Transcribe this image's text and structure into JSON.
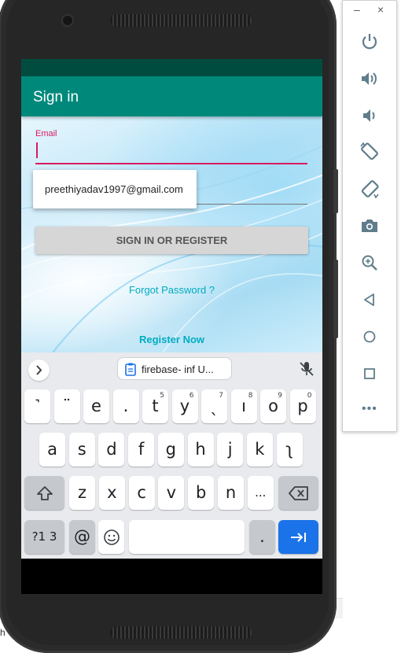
{
  "window": {
    "minimize_label": "–",
    "close_label": "×"
  },
  "desktop": {
    "fragment_text": "h"
  },
  "app": {
    "title": "Sign in",
    "email_label": "Email",
    "email_value": "",
    "autofill_suggestion": "preethiyadav1997@gmail.com",
    "signin_button": "SIGN IN OR REGISTER",
    "forgot_link": "Forgot Password ?",
    "register_link": "Register Now"
  },
  "keyboard": {
    "clipboard_chip": "firebase- inf  U...",
    "row1": [
      {
        "k": "˺",
        "s": ""
      },
      {
        "k": "¨",
        "s": ""
      },
      {
        "k": "e",
        "s": ""
      },
      {
        "k": ".",
        "s": ""
      },
      {
        "k": "t",
        "s": "5"
      },
      {
        "k": "y",
        "s": "6"
      },
      {
        "k": "ˎ",
        "s": "7"
      },
      {
        "k": "ı",
        "s": "8"
      },
      {
        "k": "o",
        "s": "9"
      },
      {
        "k": "p",
        "s": "0"
      }
    ],
    "row2": [
      "a",
      "s",
      "d",
      "f",
      "g",
      "h",
      "j",
      "k",
      "ʅ"
    ],
    "row3": [
      "z",
      "x",
      "c",
      "v",
      "b",
      "n",
      "..."
    ],
    "symbols_key": "?1 3",
    "at_key": "@",
    "period_key": "."
  },
  "colors": {
    "status_bar": "#004d40",
    "app_bar": "#00897b",
    "accent": "#d81b60",
    "link": "#00acc1",
    "action_key": "#1a73e8"
  },
  "icons": {
    "toolbar": [
      "power-icon",
      "volume-up-icon",
      "volume-down-icon",
      "rotate-left-icon",
      "rotate-right-icon",
      "camera-icon",
      "zoom-icon",
      "back-icon",
      "home-icon",
      "overview-icon",
      "more-icon"
    ]
  }
}
